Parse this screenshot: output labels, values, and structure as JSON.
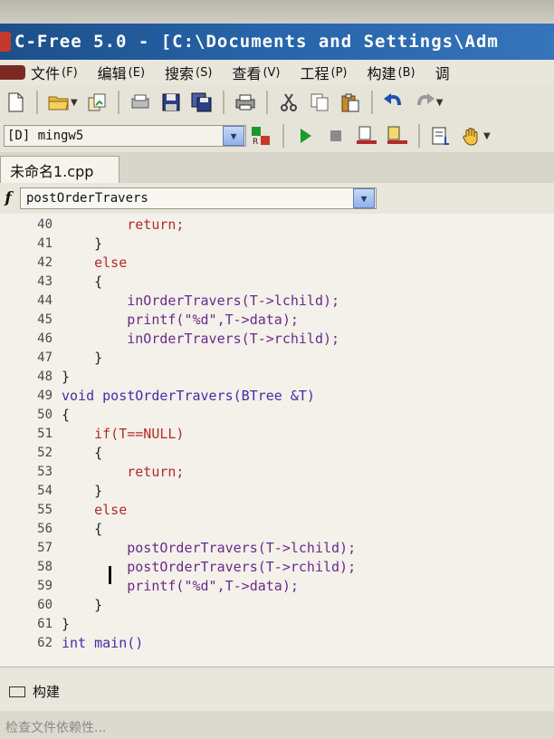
{
  "window": {
    "title": "C-Free 5.0 - [C:\\Documents and Settings\\Adm"
  },
  "menu": {
    "items": [
      {
        "label": "文件",
        "accel": "(F)"
      },
      {
        "label": "编辑",
        "accel": "(E)"
      },
      {
        "label": "搜索",
        "accel": "(S)"
      },
      {
        "label": "查看",
        "accel": "(V)"
      },
      {
        "label": "工程",
        "accel": "(P)"
      },
      {
        "label": "构建",
        "accel": "(B)"
      },
      {
        "label": "调",
        "accel": ""
      }
    ]
  },
  "toolbar": {
    "icons": [
      "new-file-icon",
      "open-folder-icon",
      "copy-file-icon",
      "print-preview-icon",
      "save-icon",
      "save-all-icon",
      "print-icon",
      "cut-icon",
      "copy-icon",
      "paste-icon",
      "undo-icon",
      "redo-icon"
    ]
  },
  "buildbar": {
    "compiler": "[D] mingw5",
    "icons": [
      "reset-compiler-icon",
      "run-icon",
      "stop-icon",
      "compile-icon",
      "build-icon",
      "debug-list-icon",
      "hand-icon"
    ],
    "colors": {
      "run": "#1b9a2a",
      "stop": "#8a8a8a"
    }
  },
  "tabs": [
    {
      "label": "未命名1.cpp",
      "active": true
    }
  ],
  "function_selector": {
    "glyph": "f",
    "value": "postOrderTravers"
  },
  "editor": {
    "lines": [
      {
        "n": "40",
        "text": "        return;",
        "kind": "kw"
      },
      {
        "n": "41",
        "text": "    }",
        "kind": "pl"
      },
      {
        "n": "42",
        "text": "    else",
        "kind": "kw"
      },
      {
        "n": "43",
        "text": "    {",
        "kind": "pl"
      },
      {
        "n": "44",
        "text": "        inOrderTravers(T->lchild);",
        "kind": "fn"
      },
      {
        "n": "45",
        "text": "        printf(\"%d\",T->data);",
        "kind": "fn"
      },
      {
        "n": "46",
        "text": "        inOrderTravers(T->rchild);",
        "kind": "fn"
      },
      {
        "n": "47",
        "text": "    }",
        "kind": "pl"
      },
      {
        "n": "48",
        "text": "}",
        "kind": "pl"
      },
      {
        "n": "49",
        "text": "void postOrderTravers(BTree &T)",
        "kind": "ty"
      },
      {
        "n": "50",
        "text": "{",
        "kind": "pl"
      },
      {
        "n": "51",
        "text": "    if(T==NULL)",
        "kind": "kw"
      },
      {
        "n": "52",
        "text": "    {",
        "kind": "pl"
      },
      {
        "n": "53",
        "text": "        return;",
        "kind": "kw"
      },
      {
        "n": "54",
        "text": "    }",
        "kind": "pl"
      },
      {
        "n": "55",
        "text": "    else",
        "kind": "kw"
      },
      {
        "n": "56",
        "text": "    {",
        "kind": "pl"
      },
      {
        "n": "57",
        "text": "        postOrderTravers(T->lchild);",
        "kind": "fn"
      },
      {
        "n": "58",
        "text": "        postOrderTravers(T->rchild);",
        "kind": "fn"
      },
      {
        "n": "59",
        "text": "        printf(\"%d\",T->data);",
        "kind": "fn"
      },
      {
        "n": "60",
        "text": "    }",
        "kind": "pl"
      },
      {
        "n": "61",
        "text": "}",
        "kind": "pl"
      },
      {
        "n": "62",
        "text": "int main()",
        "kind": "ty"
      }
    ]
  },
  "bottom_panel": {
    "tab_label": "构建",
    "output": "检查文件依赖性..."
  }
}
